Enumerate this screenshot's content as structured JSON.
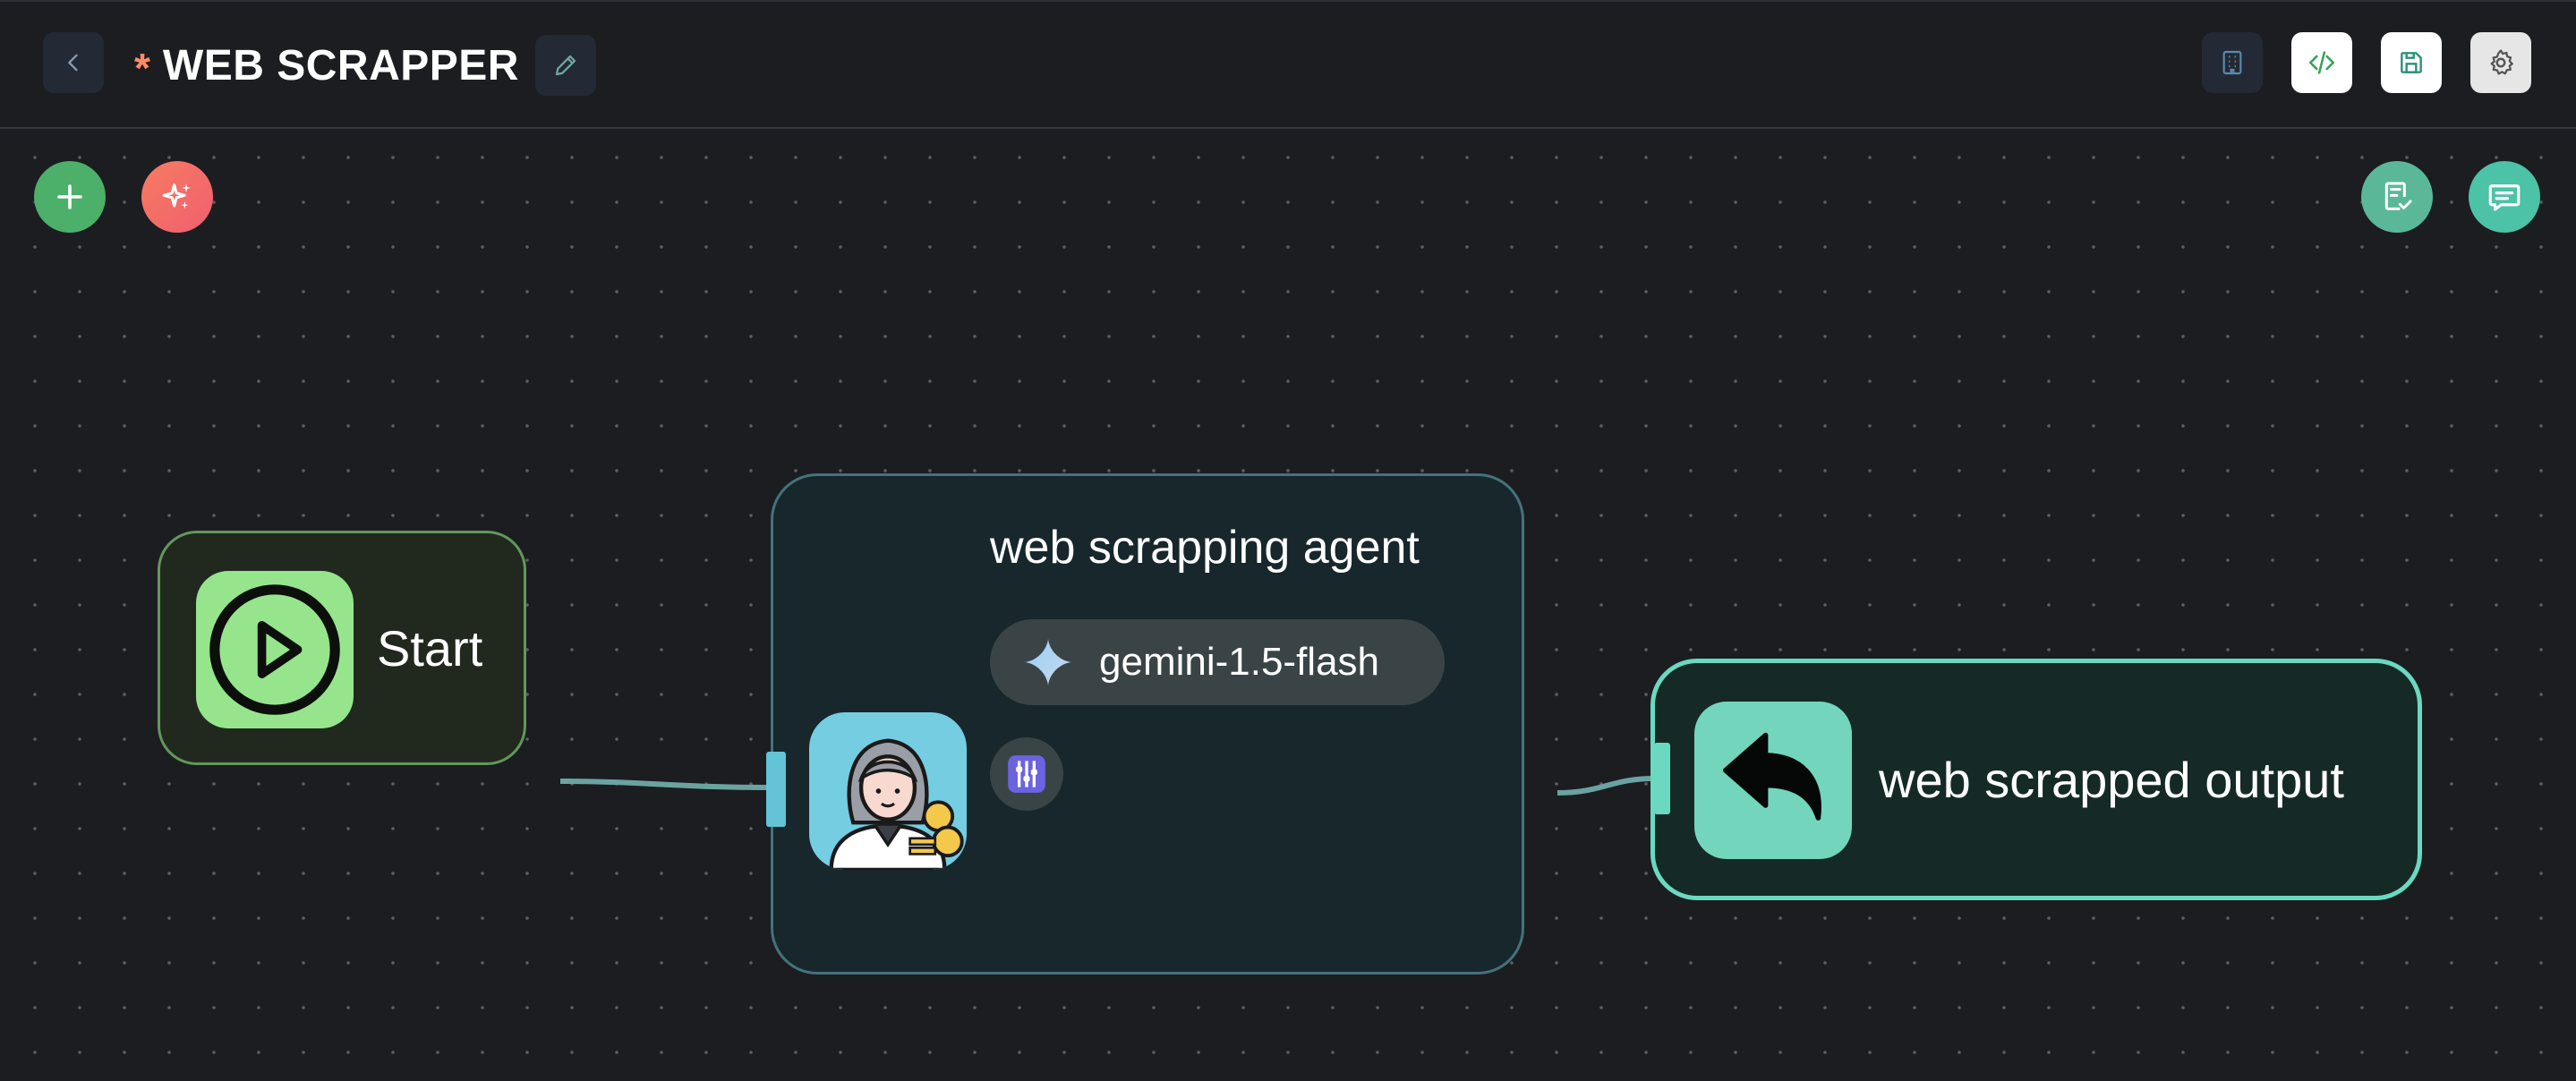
{
  "header": {
    "unsaved_marker": "*",
    "title": "WEB SCRAPPER",
    "back_icon": "chevron-left-icon",
    "edit_icon": "pencil-icon",
    "actions": [
      {
        "name": "organization",
        "icon": "building-icon"
      },
      {
        "name": "code",
        "icon": "code-icon"
      },
      {
        "name": "save",
        "icon": "save-icon"
      },
      {
        "name": "settings",
        "icon": "gear-icon"
      }
    ]
  },
  "canvas": {
    "left_actions": [
      {
        "name": "add-node",
        "icon": "plus-icon",
        "color": "#4caf6a"
      },
      {
        "name": "ai-generate",
        "icon": "sparkles-icon",
        "color": "#f2696a"
      }
    ],
    "right_actions": [
      {
        "name": "validate",
        "icon": "clipboard-check-icon",
        "color": "#5ab898"
      },
      {
        "name": "chat",
        "icon": "chat-icon",
        "color": "#4cc2a6"
      }
    ]
  },
  "nodes": {
    "start": {
      "label": "Start",
      "icon": "play-icon",
      "color": "#96e58d"
    },
    "agent": {
      "title": "web scrapping agent",
      "icon": "agent-avatar-icon",
      "model": "gemini-1.5-flash",
      "model_icon": "gemini-sparkle-icon",
      "tools_icon": "sliders-icon"
    },
    "output": {
      "label": "web scrapped output",
      "icon": "reply-arrow-icon",
      "color": "#73d6bc"
    }
  },
  "colors": {
    "background": "#1b1d21",
    "start_border": "#62985a",
    "agent_border": "#45727a",
    "output_border": "#6ad9c0"
  }
}
